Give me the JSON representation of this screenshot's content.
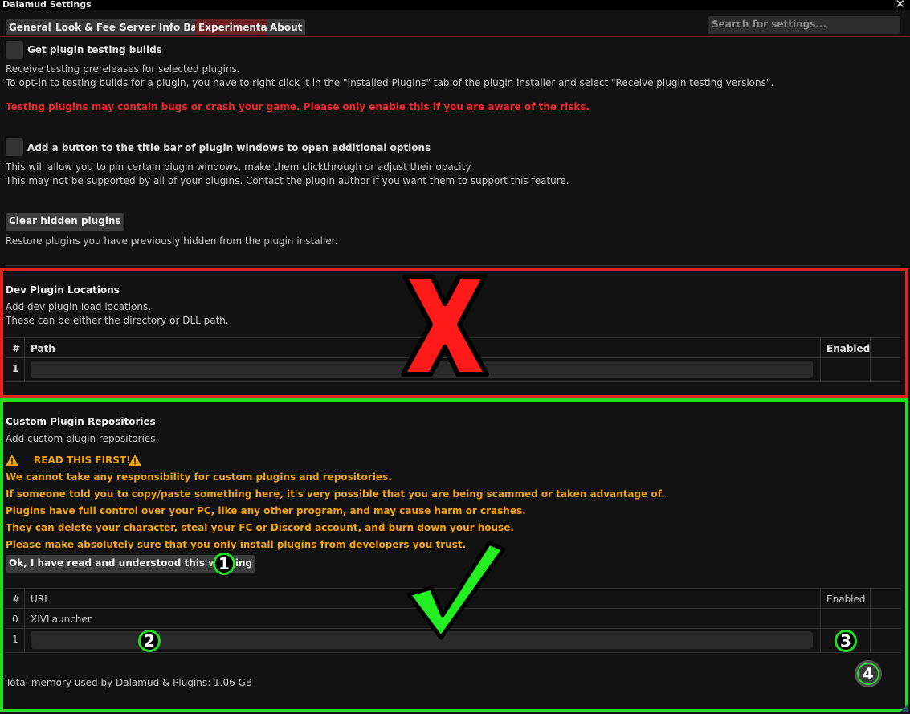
{
  "window": {
    "title": "Dalamud Settings",
    "close_glyph": "✕"
  },
  "tabs": [
    {
      "label": "General",
      "active": false
    },
    {
      "label": "Look & Feel",
      "active": false
    },
    {
      "label": "Server Info Bar",
      "active": false
    },
    {
      "label": "Experimental",
      "active": true
    },
    {
      "label": "About",
      "active": false
    }
  ],
  "search": {
    "placeholder": "Search for settings..."
  },
  "testing": {
    "label": "Get plugin testing builds",
    "desc1": "Receive testing prereleases for selected plugins.",
    "desc2": "To opt-in to testing builds for a plugin, you have to right click it in the \"Installed Plugins\" tab of the plugin installer and select \"Receive plugin testing versions\".",
    "warning": "Testing plugins may contain bugs or crash your game. Please only enable this if you are aware of the risks."
  },
  "titlebar_option": {
    "label": "Add a button to the title bar of plugin windows to open additional options",
    "desc1": "This will allow you to pin certain plugin windows, make them clickthrough or adjust their opacity.",
    "desc2": "This may not be supported by all of your plugins. Contact the plugin author if you want them to support this feature."
  },
  "hidden": {
    "button": "Clear hidden plugins",
    "desc": "Restore plugins you have previously hidden from the plugin installer."
  },
  "dev": {
    "heading": "Dev Plugin Locations",
    "desc1": "Add dev plugin load locations.",
    "desc2": "These can be either the directory or DLL path.",
    "col_num": "#",
    "col_path": "Path",
    "col_enabled": "Enabled",
    "rows": [
      {
        "num": "1",
        "path": ""
      }
    ]
  },
  "repos": {
    "heading": "Custom Plugin Repositories",
    "desc": "Add custom plugin repositories.",
    "read_first": "READ THIS FIRST!",
    "warnings": [
      "We cannot take any responsibility for custom plugins and repositories.",
      "If someone told you to copy/paste something here, it's very possible that you are being scammed or taken advantage of.",
      "Plugins have full control over your PC, like any other program, and may cause harm or crashes.",
      "They can delete your character, steal your FC or Discord account, and burn down your house.",
      "Please make absolutely sure that you only install plugins from developers you trust."
    ],
    "ack_button": "Ok, I have read and understood this warning",
    "col_num": "#",
    "col_url": "URL",
    "col_enabled": "Enabled",
    "rows": [
      {
        "num": "0",
        "url": "XIVLauncher"
      },
      {
        "num": "1",
        "url": ""
      }
    ]
  },
  "footer": {
    "memory": "Total memory used by Dalamud & Plugins: 1.06 GB"
  },
  "annotations": {
    "markers": [
      "1",
      "2",
      "3",
      "4"
    ],
    "colors": {
      "reject": "#e12222",
      "accept": "#22dd22"
    }
  }
}
